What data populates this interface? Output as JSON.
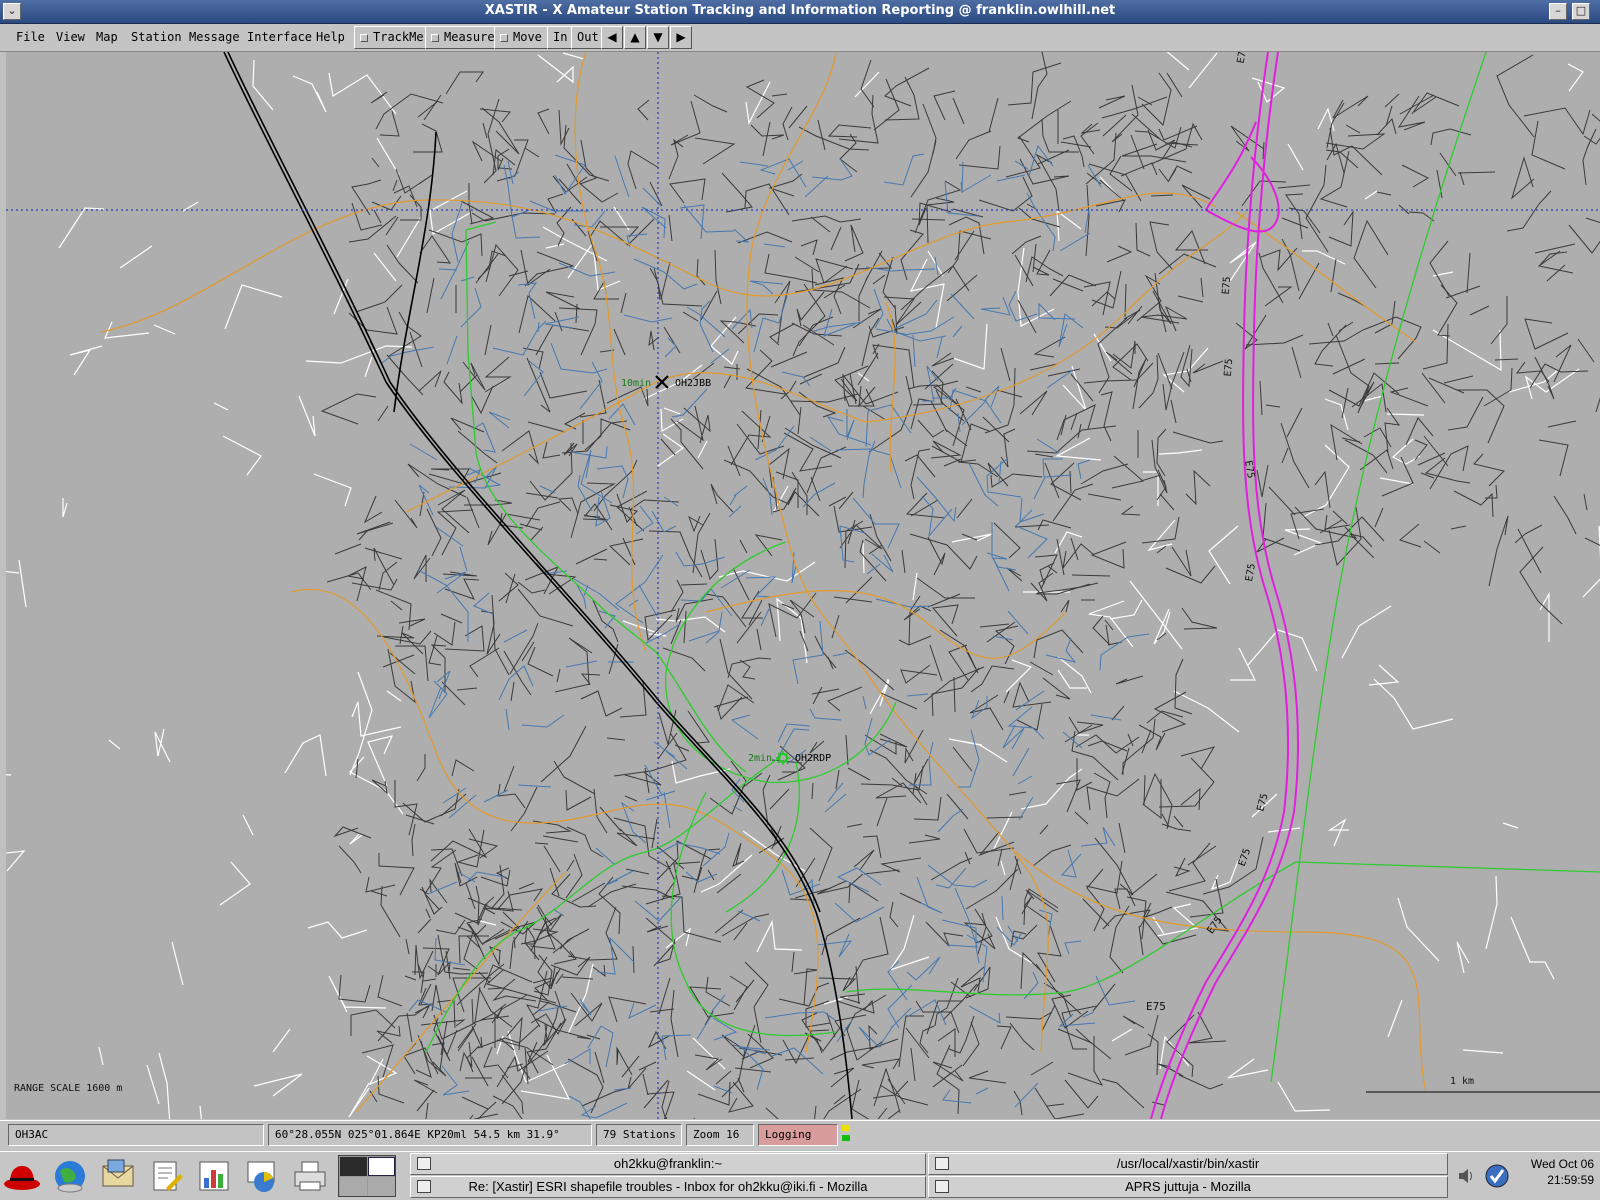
{
  "window": {
    "title": "XASTIR - X Amateur Station Tracking and Information Reporting @ franklin.owlhill.net"
  },
  "menubar": {
    "items": [
      "File",
      "View",
      "Map",
      "Station",
      "Message",
      "Interface",
      "Help"
    ],
    "toggles": [
      "TrackMe",
      "Measure",
      "Move"
    ],
    "zoom_in": "In",
    "zoom_out": "Out",
    "pan": {
      "left": "◀",
      "up": "▲",
      "down": "▼",
      "right": "▶"
    }
  },
  "map": {
    "road_colors": {
      "minor": "#3a3a3a",
      "street": "#4678b0",
      "main": "#e39a2c",
      "highway": "#e020e0",
      "green": "#2ecc2e",
      "rail": "#000000",
      "path": "#ffffff"
    },
    "stations": [
      {
        "age": "10min",
        "call": "OH2JBB",
        "symbol": "x-mark-icon"
      },
      {
        "age": "2min",
        "call": "OH2RDP",
        "symbol": "star-icon"
      }
    ],
    "road_labels": [
      "E7",
      "E75",
      "E75",
      "E75",
      "E75",
      "E75",
      "E75",
      "E75",
      "E75"
    ],
    "range_scale": "RANGE SCALE 1600 m",
    "scale_bar": "1 km"
  },
  "statusbar": {
    "callsign": "OH3AC",
    "position": "60°28.055N  025°01.864E  KP20ml 54.5 km 31.9°",
    "stations": "79 Stations",
    "zoom": "Zoom 16",
    "logging": "Logging"
  },
  "taskbar": {
    "tasks": [
      "oh2kku@franklin:~",
      "/usr/local/xastir/bin/xastir",
      "Re: [Xastir] ESRI shapefile troubles - Inbox for oh2kku@iki.fi - Mozilla",
      "APRS juttuja - Mozilla"
    ],
    "clock_date": "Wed Oct 06",
    "clock_time": "21:59:59"
  }
}
